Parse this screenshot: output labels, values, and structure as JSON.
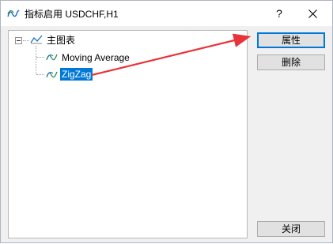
{
  "window": {
    "title": "指标启用 USDCHF,H1",
    "help_label": "?",
    "close_label": "✕"
  },
  "tree": {
    "root_label": "主图表",
    "children": [
      {
        "label": "Moving Average",
        "icon": "indicator-wave-icon",
        "selected": false
      },
      {
        "label": "ZigZag",
        "icon": "indicator-wave-icon",
        "selected": true
      }
    ]
  },
  "buttons": {
    "properties": "属性",
    "delete": "删除",
    "close": "关闭"
  },
  "colors": {
    "selection": "#0078d7",
    "annotation_arrow": "#e8333a",
    "indicator_icon": "#2e8b57",
    "chart_icon": "#1e6ec8"
  }
}
